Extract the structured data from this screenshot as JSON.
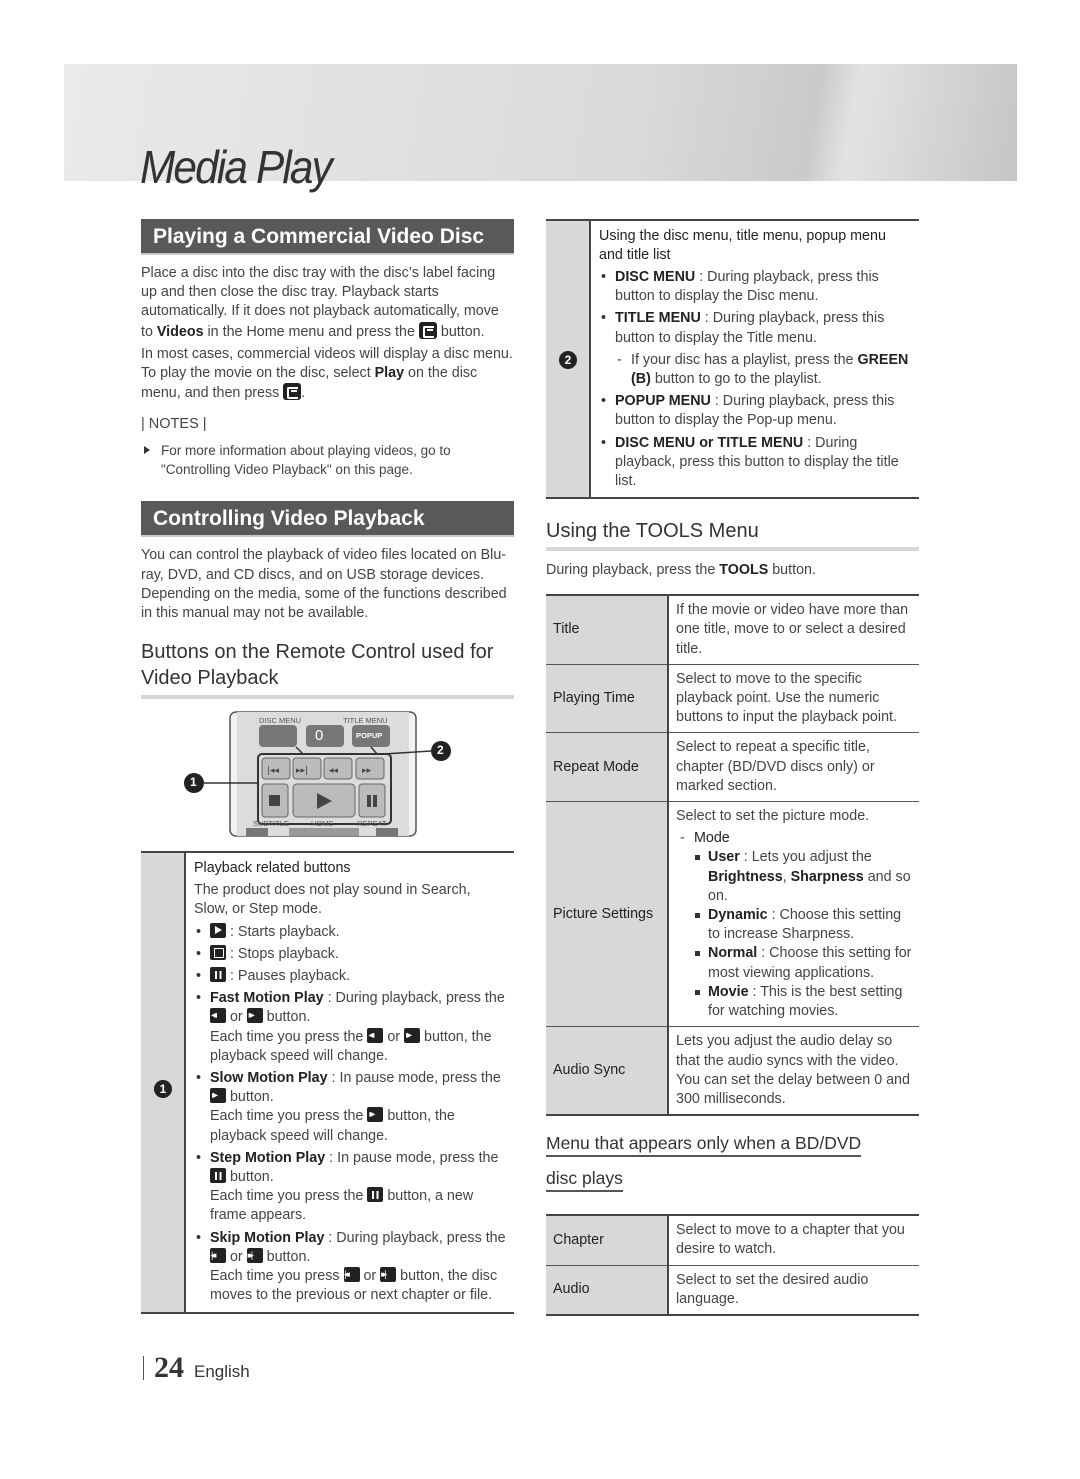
{
  "page": {
    "chapter_title": "Media Play",
    "page_number": "24",
    "language": "English"
  },
  "commercial": {
    "heading": "Playing a Commercial Video Disc",
    "para1_a": "Place a disc into the disc tray with the disc’s label facing up and then close the disc tray. Playback starts automatically. If it does not playback automatically, move to ",
    "para1_bold": "Videos",
    "para1_b": " in the Home menu and press the ",
    "para1_c": " button.",
    "para2_a": "In most cases, commercial videos will display a disc menu. To play the movie on the disc, select ",
    "para2_bold": "Play",
    "para2_b": " on the disc menu, and then press ",
    "para2_c": ".",
    "notes_label": "| NOTES |",
    "note1": "For more information about playing videos, go to \"Controlling Video Playback\" on this page."
  },
  "controlling": {
    "heading": "Controlling Video Playback",
    "intro": "You can control the playback of video files located on Blu-ray, DVD, and CD discs, and on USB storage devices. Depending on the media, some of the functions described in this manual may not be available.",
    "subheading": "Buttons on the Remote Control used for Video Playback",
    "remote": {
      "disc_menu": "DISC MENU",
      "title_menu": "TITLE MENU",
      "zero": "0",
      "popup": "POPUP",
      "subtitle": "SUBTITLE",
      "home": "HOME",
      "repeat": "REPEAT",
      "callout1": "1",
      "callout2": "2"
    },
    "table1": {
      "marker": "1",
      "title": "Playback related buttons",
      "note": "The product does not play sound in Search, Slow, or Step mode.",
      "play": ": Starts playback.",
      "stop": ": Stops playback.",
      "pause": ": Pauses playback.",
      "fast_label": "Fast Motion Play",
      "fast_a": " : During playback, press the ",
      "or": " or ",
      "button": " button.",
      "each_press_the": "Each time you press the ",
      "fast_tail": " button, the playback speed will change.",
      "slow_label": "Slow Motion Play",
      "slow_a": " : In pause mode, press the ",
      "slow_tail": " button, the playback speed will change.",
      "step_label": "Step Motion Play",
      "step_a": " : In pause mode, press the ",
      "step_tail": " button, a new frame appears.",
      "skip_label": "Skip Motion Play",
      "skip_a": " : During playback, press the ",
      "each_press": "Each time you press ",
      "skip_tail": " button, the disc moves to the previous or next chapter or file."
    }
  },
  "table2": {
    "marker": "2",
    "title": "Using the disc menu, title menu, popup menu and title list",
    "disc_label": "DISC MENU",
    "disc_text": " : During playback, press this button to display the Disc menu.",
    "title_label": "TITLE MENU",
    "title_text": " : During playback, press this button to display the Title menu.",
    "green_a": "If your disc has a playlist, press the ",
    "green_bold": "GREEN (B)",
    "green_b": " button to go to the playlist.",
    "popup_label": "POPUP MENU",
    "popup_text": " : During playback, press this button to display the Pop-up menu.",
    "dt_label": "DISC MENU or TITLE MENU",
    "dt_text": " : During playback, press this button to display the title list."
  },
  "tools": {
    "heading": "Using the TOOLS Menu",
    "intro_a": "During playback, press the ",
    "intro_bold": "TOOLS",
    "intro_b": " button.",
    "rows": [
      {
        "label": "Title",
        "value": "If the movie or video have more than one title, move to or select a desired title."
      },
      {
        "label": "Playing Time",
        "value": "Select to move to the specific playback point. Use the numeric buttons to input the playback point."
      },
      {
        "label": "Repeat Mode",
        "value": "Select to repeat a specific title, chapter (BD/DVD discs only) or marked section."
      },
      {
        "label": "Picture Settings",
        "value": "Select to set the picture mode."
      },
      {
        "label": "Audio Sync",
        "value": "Lets you adjust the audio delay so that the audio syncs with the video. You can set the delay between 0 and 300 milliseconds."
      }
    ],
    "picture": {
      "mode": "Mode",
      "user_label": "User",
      "user_a": " : Lets you adjust the ",
      "brightness": "Brightness",
      "comma": ", ",
      "sharpness": "Sharpness",
      "user_b": " and so on.",
      "dynamic_label": "Dynamic",
      "dynamic_text": " : Choose this setting to increase Sharpness.",
      "normal_label": "Normal",
      "normal_text": " : Choose this setting for most viewing applications.",
      "movie_label": "Movie",
      "movie_text": " : This is the best setting for watching movies."
    }
  },
  "bd_menu": {
    "heading_line1": "Menu that appears only when a BD/DVD",
    "heading_line2": "disc plays",
    "rows": [
      {
        "label": "Chapter",
        "value": "Select to move to a chapter that you desire to watch."
      },
      {
        "label": "Audio",
        "value": "Select to set the desired audio language."
      }
    ]
  }
}
